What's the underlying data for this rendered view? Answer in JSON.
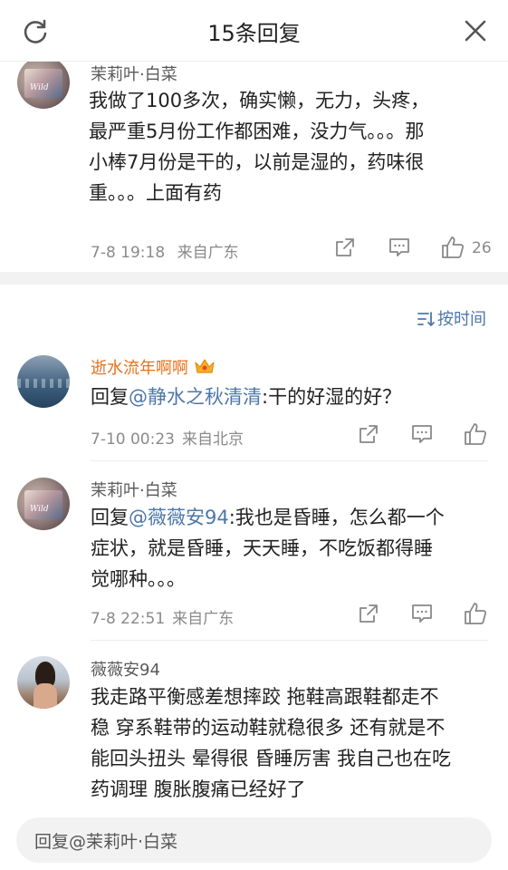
{
  "header": {
    "title": "15条回复",
    "refresh_icon": "refresh-icon",
    "close_icon": "close-icon"
  },
  "main_comment": {
    "author": "茉莉叶·白菜",
    "avatar_tag": "Wild",
    "lines": [
      "我做了100多次，确实懒，无力，头疼，",
      "最严重5月份工作都困难，没力气。。。那",
      "小棒7月份是干的，以前是湿的，药味很",
      "重。。。上面有药"
    ],
    "date": "7-8 19:18",
    "location": "来自广东",
    "like_count": "26"
  },
  "sort": {
    "label": "按时间",
    "icon": "sort-icon"
  },
  "replies": [
    {
      "author": "逝水流年啊啊",
      "vip": true,
      "badge_icon": "crown-icon",
      "reply_prefix": "回复",
      "mention": "@静水之秋清清",
      "lines_first_tail": ":干的好湿的好？",
      "lines": [],
      "date": "7-10 00:23",
      "location": "来自北京"
    },
    {
      "author": "茉莉叶·白菜",
      "avatar_tag": "Wild",
      "reply_prefix": "回复",
      "mention": "@薇薇安94",
      "lines_first_tail": ":我也是昏睡，怎么都一个",
      "lines": [
        "症状，就是昏睡，天天睡，不吃饭都得睡",
        "觉哪种。。。"
      ],
      "date": "7-8 22:51",
      "location": "来自广东"
    },
    {
      "author": "薇薇安94",
      "lines": [
        "我走路平衡感差想摔跤 拖鞋高跟鞋都走不",
        "稳 穿系鞋带的运动鞋就稳很多 还有就是不",
        "能回头扭头 晕得很 昏睡厉害 我自己也在吃",
        "药调理 腹胀腹痛已经好了"
      ]
    }
  ],
  "reply_input": {
    "placeholder": "回复@茉莉叶·白菜"
  },
  "colors": {
    "link": "#4d77a9",
    "vip_name": "#e8701a",
    "meta": "#8a8a8a",
    "section_gap": "#f2f2f2"
  }
}
